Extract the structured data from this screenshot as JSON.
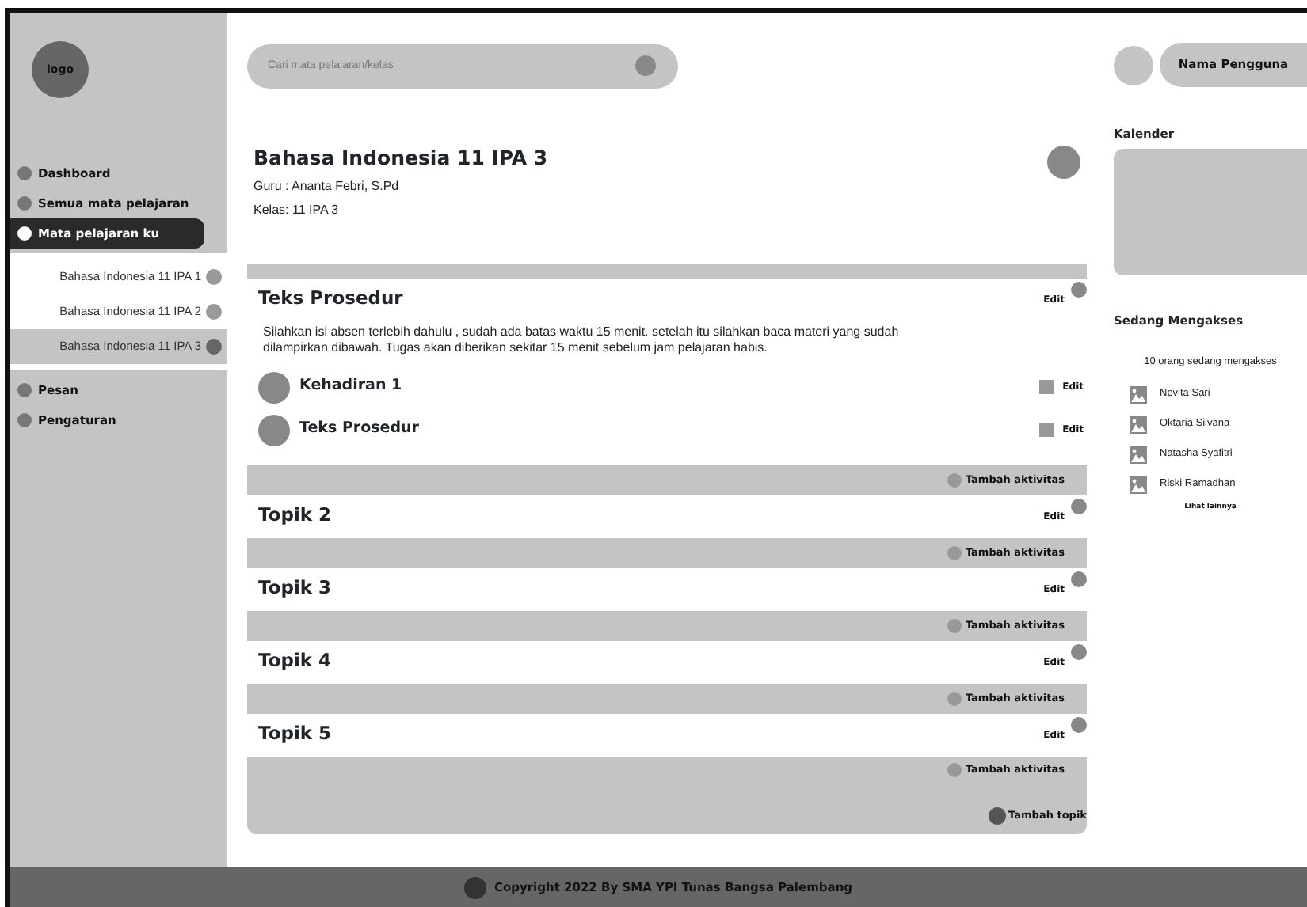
{
  "logo": {
    "label": "logo"
  },
  "sidebar": {
    "items": [
      {
        "label": "Dashboard",
        "selected": false
      },
      {
        "label": "Semua mata pelajaran",
        "selected": false
      },
      {
        "label": "Mata pelajaran ku",
        "selected": true,
        "expanded": true,
        "children": [
          {
            "label": "Bahasa Indonesia 11 IPA 1",
            "selected": false
          },
          {
            "label": "Bahasa Indonesia 11 IPA 2",
            "selected": false
          },
          {
            "label": "Bahasa Indonesia 11 IPA 3",
            "selected": true
          }
        ]
      },
      {
        "label": "Pesan",
        "selected": false
      },
      {
        "label": "Pengaturan",
        "selected": false
      }
    ]
  },
  "search": {
    "placeholder": "Cari mata pelajaran/kelas"
  },
  "user": {
    "name": "Nama Pengguna"
  },
  "course": {
    "title": "Bahasa Indonesia 11 IPA 3",
    "teacher": "Guru : Ananta Febri, S.Pd",
    "class": "Kelas: 11 IPA 3"
  },
  "topics": [
    {
      "title": "Teks Prosedur",
      "edit": "Edit",
      "description": "Silahkan isi absen terlebih dahulu , sudah ada batas waktu 15 menit. setelah itu silahkan baca materi yang sudah dilampirkan dibawah. Tugas akan diberikan sekitar 15 menit sebelum jam pelajaran habis.",
      "activities": [
        {
          "name": "Kehadiran 1",
          "edit": "Edit"
        },
        {
          "name": "Teks Prosedur",
          "edit": "Edit"
        }
      ],
      "add_activity": "Tambah aktivitas"
    },
    {
      "title": "Topik 2",
      "edit": "Edit",
      "add_activity": "Tambah aktivitas"
    },
    {
      "title": "Topik 3",
      "edit": "Edit",
      "add_activity": "Tambah aktivitas"
    },
    {
      "title": "Topik 4",
      "edit": "Edit",
      "add_activity": "Tambah aktivitas"
    },
    {
      "title": "Topik 5",
      "edit": "Edit",
      "add_activity": "Tambah aktivitas"
    }
  ],
  "add_topic": "Tambah topik",
  "calendar": {
    "title": "Kalender"
  },
  "online": {
    "title": "Sedang Mengakses",
    "count": "10 orang sedang mengakses",
    "users": [
      "Novita Sari",
      "Oktaria Silvana",
      "Natasha Syafitri",
      "Riski Ramadhan"
    ],
    "more": "Lihat lainnya"
  },
  "footer": "Copyright 2022 By SMA YPI Tunas Bangsa Palembang"
}
